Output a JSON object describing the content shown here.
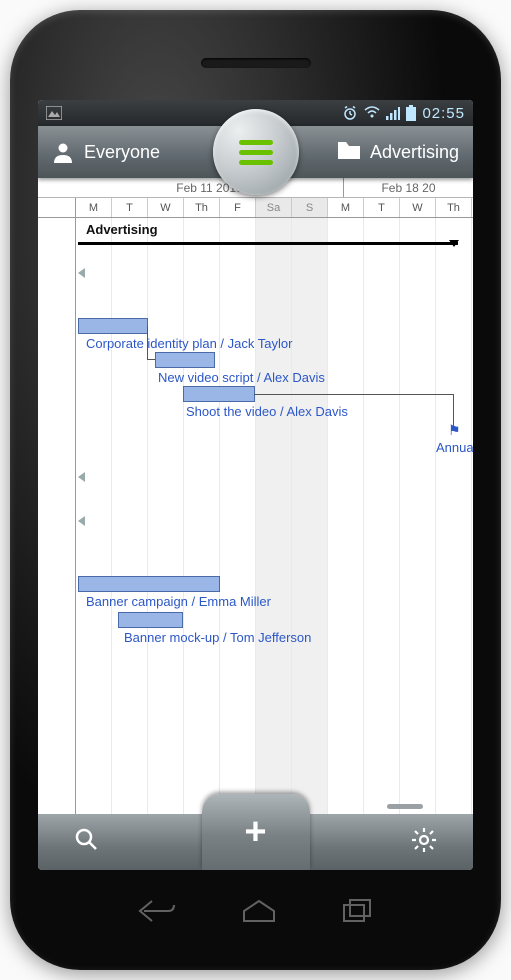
{
  "statusbar": {
    "clock": "02:55"
  },
  "header": {
    "leftLabel": "Everyone",
    "rightLabel": "Advertising"
  },
  "weekLabels": {
    "current": "Feb 11 2013",
    "next": "Feb 18 20"
  },
  "dayCols": [
    "M",
    "T",
    "W",
    "Th",
    "F",
    "Sa",
    "S",
    "M",
    "T",
    "W",
    "Th"
  ],
  "group": {
    "title": "Advertising"
  },
  "tasks": [
    {
      "label": "Corporate identity plan / Jack Taylor"
    },
    {
      "label": "New video script / Alex Davis"
    },
    {
      "label": "Shoot the video / Alex Davis"
    },
    {
      "label": "Annual Con"
    },
    {
      "label": "Banner campaign / Emma Miller"
    },
    {
      "label": "Banner mock-up / Tom Jefferson"
    }
  ]
}
